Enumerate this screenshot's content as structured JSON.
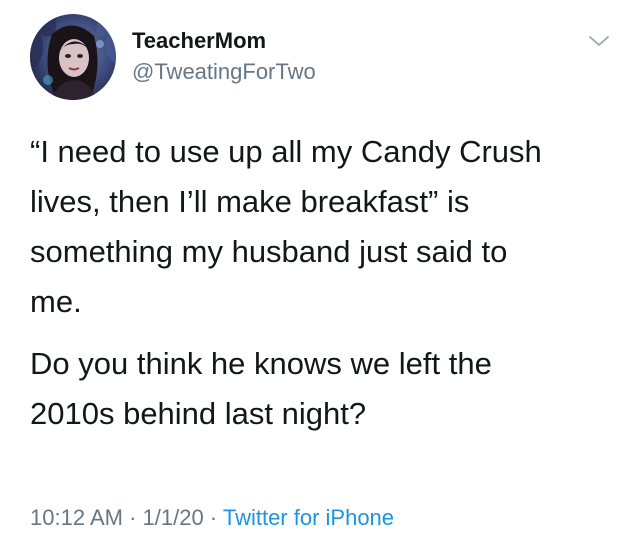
{
  "author": {
    "display_name": "TeacherMom",
    "handle": "@TweatingForTwo",
    "avatar_icon": "profile-photo-avatar"
  },
  "menu": {
    "icon": "chevron-down-icon"
  },
  "tweet": {
    "paragraph_1": [
      "“I need to use up all my Candy Crush",
      "lives, then I’ll make breakfast” is",
      "something my husband just said to",
      "me."
    ],
    "paragraph_2": [
      "Do you think he knows we left the",
      "2010s behind last night?"
    ]
  },
  "meta": {
    "time": "10:12 AM",
    "separator": " · ",
    "date": "1/1/20",
    "source": "Twitter for iPhone"
  },
  "colors": {
    "text": "#14171a",
    "secondary": "#657786",
    "link": "#1b95e0"
  }
}
